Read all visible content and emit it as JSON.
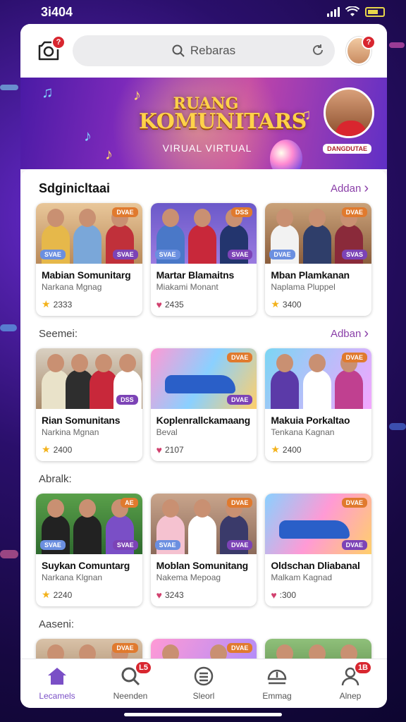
{
  "status_bar": {
    "time": "3i404"
  },
  "topbar": {
    "camera_badge": "?",
    "search_placeholder": "Rebaras",
    "avatar_badge": "?"
  },
  "banner": {
    "title_line1": "RUANG",
    "title_line2": "KOMUNITARS",
    "subtitle": "VIRUAL VIRTUAL",
    "host_label": "DANGDUTAE"
  },
  "sections": [
    {
      "title": "Sdginicltaai",
      "see_all": "Addan",
      "cards": [
        {
          "title": "Mabian Somunitarg",
          "subtitle": "Narkana Mgnag",
          "stat_icon": "star",
          "stat": "2333",
          "tag_tr": "DVAE",
          "tag_bl": "SVAE",
          "tag_br": "SVAE"
        },
        {
          "title": "Martar Blamaitns",
          "subtitle": "Miakami Monant",
          "stat_icon": "heart",
          "stat": "2435",
          "tag_tr": "DSS",
          "tag_bl": "SVAE",
          "tag_br": "SVAE"
        },
        {
          "title": "Mban Plamkanan",
          "subtitle": "Naplama Pluppel",
          "stat_icon": "star",
          "stat": "3400",
          "tag_tr": "DVAE",
          "tag_bl": "DVAE",
          "tag_br": "SVAS"
        }
      ]
    },
    {
      "title": "Seemei:",
      "see_all": "Adban",
      "cards": [
        {
          "title": "Rian Somunitans",
          "subtitle": "Narkina Mgnan",
          "stat_icon": "star",
          "stat": "2400",
          "tag_tr": "",
          "tag_bl": "",
          "tag_br": "DSS"
        },
        {
          "title": "Koplenrallckamaang",
          "subtitle": "Beval",
          "stat_icon": "heart",
          "stat": "2107",
          "tag_tr": "DVAE",
          "tag_bl": "",
          "tag_br": "DVAE"
        },
        {
          "title": "Makuia Porkaltao",
          "subtitle": "Tenkana Kagnan",
          "stat_icon": "star",
          "stat": "2400",
          "tag_tr": "DVAE",
          "tag_bl": "",
          "tag_br": ""
        }
      ]
    },
    {
      "title": "Abralk:",
      "see_all": "",
      "cards": [
        {
          "title": "Suykan Comuntarg",
          "subtitle": "Narkana Klgnan",
          "stat_icon": "star",
          "stat": "2240",
          "tag_tr": "AE",
          "tag_bl": "SVAE",
          "tag_br": "SVAE"
        },
        {
          "title": "Moblan Somunitang",
          "subtitle": "Nakema Mepoag",
          "stat_icon": "heart",
          "stat": "3243",
          "tag_tr": "DVAE",
          "tag_bl": "SVAE",
          "tag_br": "DVAE"
        },
        {
          "title": "Oldschan Dliabanal",
          "subtitle": "Malkam Kagnad",
          "stat_icon": "heart",
          "stat": ":300",
          "tag_tr": "DVAE",
          "tag_bl": "",
          "tag_br": "DVAE"
        }
      ]
    },
    {
      "title": "Aaseni:",
      "see_all": "",
      "cards": [
        {
          "title": "",
          "subtitle": "",
          "stat_icon": "",
          "stat": "",
          "tag_tr": "DVAE",
          "tag_bl": "",
          "tag_br": ""
        },
        {
          "title": "",
          "subtitle": "",
          "stat_icon": "",
          "stat": "",
          "tag_tr": "DVAE",
          "tag_bl": "",
          "tag_br": ""
        },
        {
          "title": "",
          "subtitle": "",
          "stat_icon": "",
          "stat": "",
          "tag_tr": "",
          "tag_bl": "",
          "tag_br": ""
        }
      ]
    }
  ],
  "bottom_nav": [
    {
      "label": "Lecamels",
      "icon": "home-icon",
      "badge": ""
    },
    {
      "label": "Neenden",
      "icon": "search-icon",
      "badge": "L5"
    },
    {
      "label": "Sleorl",
      "icon": "list-icon",
      "badge": ""
    },
    {
      "label": "Emmag",
      "icon": "chat-icon",
      "badge": ""
    },
    {
      "label": "Alnep",
      "icon": "profile-icon",
      "badge": "1B"
    }
  ],
  "colors": {
    "accent": "#7a4fc6",
    "link": "#8a3fa8",
    "badge": "#d8262f"
  }
}
